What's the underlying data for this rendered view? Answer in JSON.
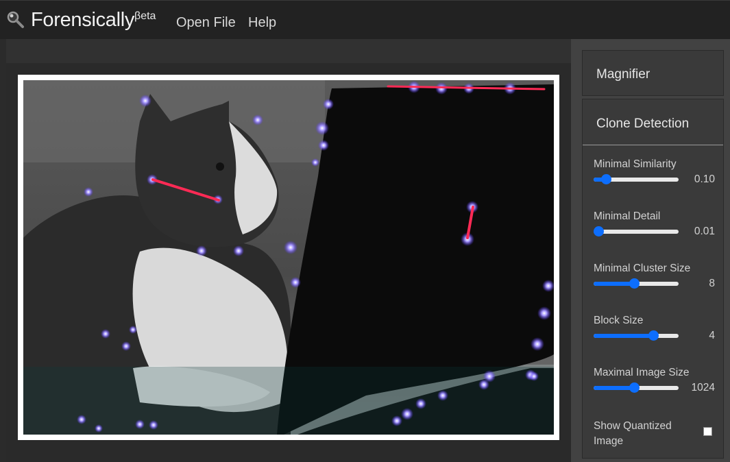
{
  "app": {
    "title": "Forensically",
    "badge": "βeta",
    "icon": "magnifier-icon"
  },
  "menu": {
    "open_file": "Open File",
    "help": "Help"
  },
  "sidebar": {
    "magnifier_panel": {
      "title": "Magnifier"
    },
    "clone_detection_panel": {
      "title": "Clone Detection",
      "controls": [
        {
          "label": "Minimal Similarity",
          "value": "0.10",
          "level": 0.1
        },
        {
          "label": "Minimal Detail",
          "value": "0.01",
          "level": 0.0
        },
        {
          "label": "Minimal Cluster Size",
          "value": "8",
          "level": 0.47
        },
        {
          "label": "Block Size",
          "value": "4",
          "level": 0.73
        },
        {
          "label": "Maximal Image Size",
          "value": "1024",
          "level": 0.47
        }
      ],
      "show_quantized": {
        "label_line1": "Show Quantized",
        "label_line2": "Image",
        "checked": false
      }
    }
  },
  "colors": {
    "accent": "#0d6efd",
    "clone_line": "#ff2a55",
    "marker": "#7b6bff"
  }
}
